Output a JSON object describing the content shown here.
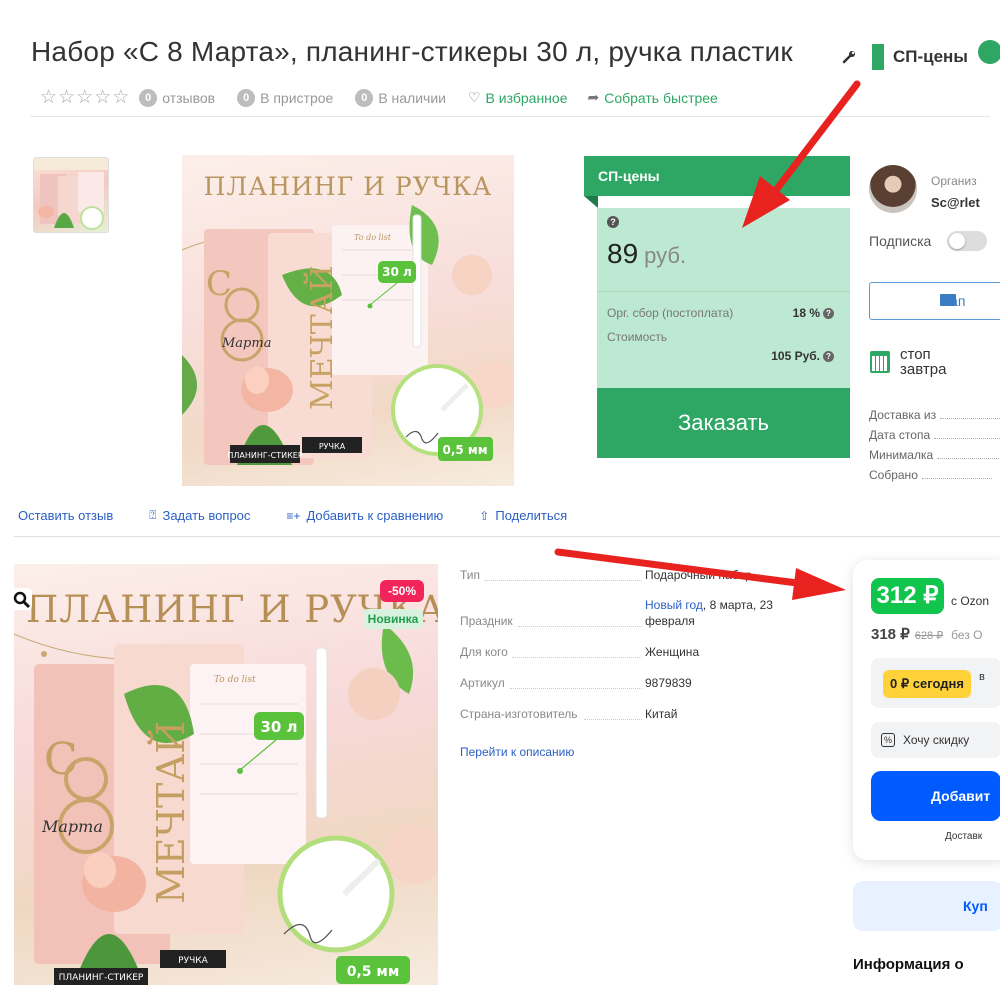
{
  "product": {
    "title": "Набор «С 8 Марта», планинг-стикеры 30 л, ручка пластик",
    "sp_tag": "СП-цены"
  },
  "meta": {
    "reviews_count": "0",
    "reviews_label": "отзывов",
    "attach_count": "0",
    "attach_label": "В пристрое",
    "stock_count": "0",
    "stock_label": "В наличии",
    "favorites_label": "В избранное",
    "collect_label": "Собрать быстрее"
  },
  "sp_box": {
    "header": "СП-цены",
    "question_mark": "?",
    "price_value": "89",
    "price_currency": "руб.",
    "fee_label": "Орг. сбор (постоплата)",
    "fee_value": "18 %",
    "cost_label": "Стоимость",
    "cost_value": "105 Руб.",
    "order_button": "Заказать"
  },
  "organizer": {
    "label": "Организ",
    "name": "Sc@rlet",
    "subscription_label": "Подписка",
    "message_button": "Нап",
    "stop_line1": "стоп",
    "stop_line2": "завтра",
    "info_rows": [
      "Доставка из",
      "Дата стопа",
      "Минималка",
      "Собрано"
    ]
  },
  "actions": {
    "review": "Оставить отзыв",
    "question": "Задать вопрос",
    "compare": "Добавить к сравнению",
    "share": "Поделиться"
  },
  "image_text": {
    "title_small": "ПЛАНИНГ И РУЧКА",
    "title_big": "ПЛАНИНГ И РУЧКА",
    "sheets": "30 л",
    "tip": "0,5 мм",
    "sticker_label": "ПЛАНИНГ-СТИКЕР",
    "pen_label": "РУЧКА",
    "dream": "МЕЧТАЙ",
    "s": "С",
    "marta": "Марта",
    "todo": "To do list"
  },
  "badges": {
    "discount": "-50%",
    "new": "Новинка"
  },
  "specs": {
    "type_label": "Тип",
    "type_value": "Подарочный набор",
    "holiday_label": "Праздник",
    "holiday_link": "Новый год",
    "holiday_rest": ", 8 марта, 23",
    "holiday_line2": "февраля",
    "for_label": "Для кого",
    "for_value": "Женщина",
    "article_label": "Артикул",
    "article_value": "9879839",
    "country_label": "Страна-изготовитель",
    "country_value": "Китай",
    "goto_description": "Перейти к описанию"
  },
  "ozon": {
    "price": "312 ₽",
    "with_card": "с Ozon",
    "old_price": "318 ₽",
    "strike_price": "628 ₽",
    "without": "без О",
    "pay_today": "0 ₽ сегодня",
    "pay_side": "в",
    "want_discount": "Хочу скидку",
    "add_button": "Добавит",
    "delivery": "Доставк",
    "buy_button": "Куп",
    "info_heading": "Информация о"
  },
  "colors": {
    "sp_green": "#2ea664",
    "sp_light": "#bde9d2",
    "ozon_green": "#10c44c",
    "ozon_blue": "#005bff",
    "discount_pink": "#f2245c",
    "arrow_red": "#e8231f"
  }
}
